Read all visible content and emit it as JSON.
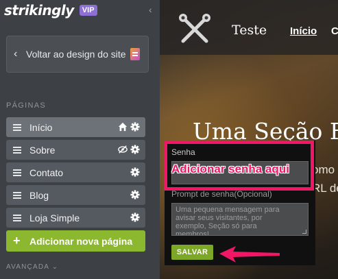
{
  "sidebar": {
    "brand": "strikingly",
    "badge": "VIP",
    "back_button": "Voltar ao design do site",
    "section_label": "PÁGINAS",
    "pages": [
      {
        "label": "Início",
        "icons": [
          "home-icon",
          "gear-icon"
        ]
      },
      {
        "label": "Sobre",
        "icons": [
          "eye-slash-icon",
          "gear-icon"
        ]
      },
      {
        "label": "Contato",
        "icons": [
          "gear-icon"
        ]
      },
      {
        "label": "Blog",
        "icons": [
          "gear-icon"
        ]
      },
      {
        "label": "Loja Simple",
        "icons": [
          "gear-icon"
        ]
      }
    ],
    "add_page": "Adicionar nova página",
    "advanced": "AVANÇADA"
  },
  "preview": {
    "site_title": "Teste",
    "nav": [
      "Início",
      "C"
    ],
    "hero_title": "Uma Seção F",
    "hero_text": [
      "omo",
      "RL de"
    ]
  },
  "password_popup": {
    "password_label": "Senha",
    "annotation": "Adicionar senha aqui",
    "prompt_label": "Prompt de senha(Opcional)",
    "prompt_placeholder": [
      "Uma pequena mensagem para",
      "avisar seus visitantes, por",
      "exemplo, Seção só para",
      "membros!"
    ],
    "save_button": "SALVAR"
  },
  "colors": {
    "highlight": "#f01766",
    "accent_green": "#8cb82f",
    "vip_purple": "#8d6fd6"
  }
}
